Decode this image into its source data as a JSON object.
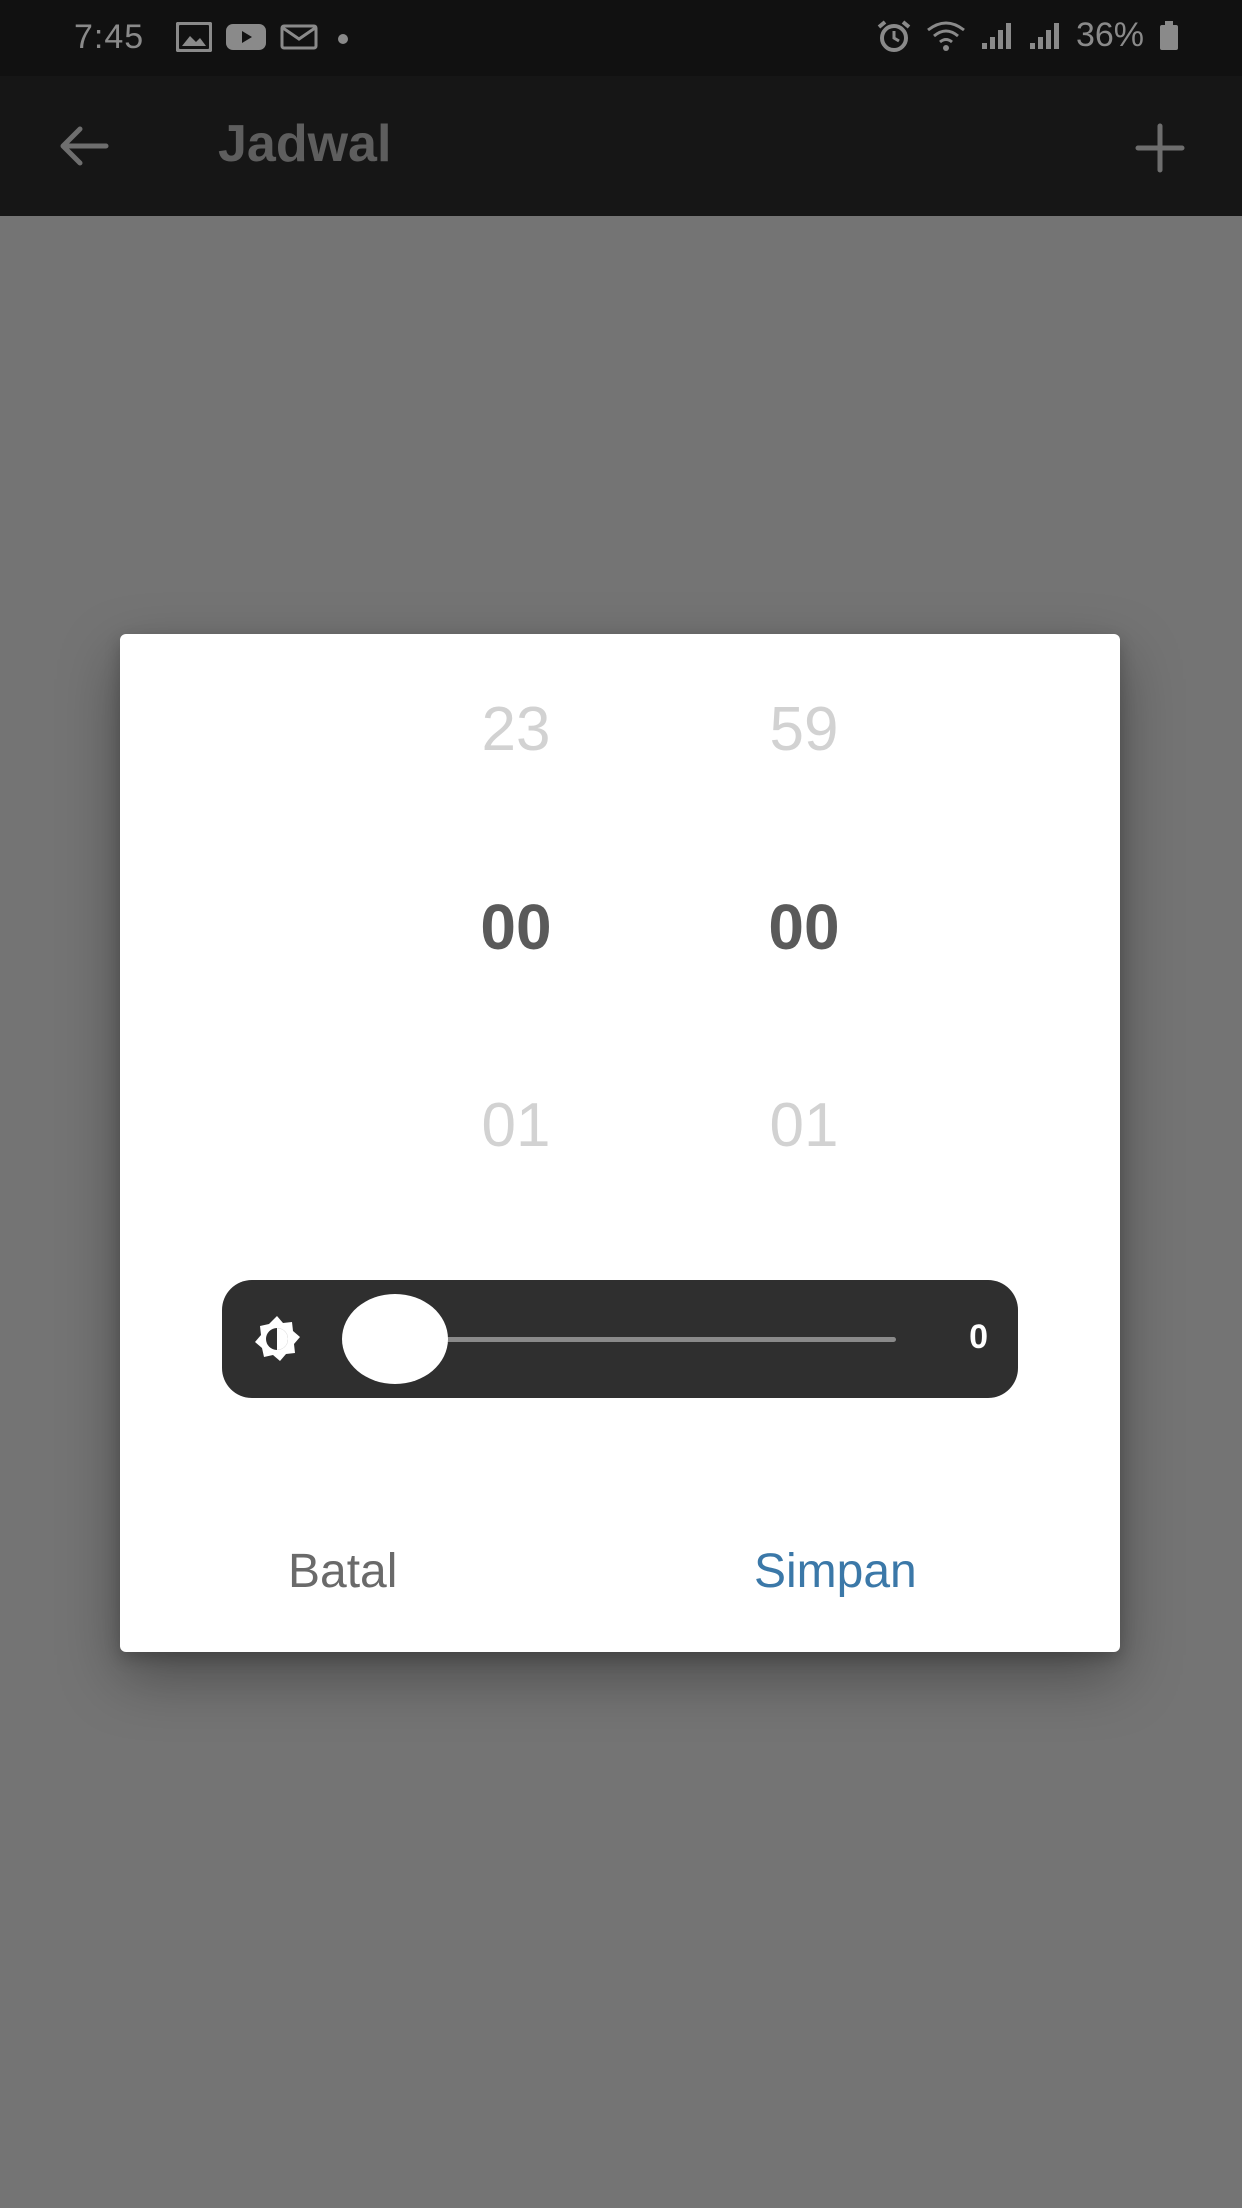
{
  "status_bar": {
    "time": "7:45",
    "battery": "36%",
    "left_icons": [
      "image-icon",
      "youtube-icon",
      "mail-icon",
      "dot-icon"
    ],
    "right_icons": [
      "alarm-icon",
      "wifi-icon",
      "signal-icon",
      "signal-icon",
      "battery-icon"
    ]
  },
  "app_bar": {
    "title": "Jadwal",
    "back_icon": "arrow-left-icon",
    "add_icon": "plus-icon"
  },
  "dialog": {
    "hour_picker": {
      "prev": "23",
      "current": "00",
      "next": "01"
    },
    "minute_picker": {
      "prev": "59",
      "current": "00",
      "next": "01"
    },
    "brightness": {
      "icon": "brightness-icon",
      "value": 0,
      "value_label": "0"
    },
    "cancel_label": "Batal",
    "save_label": "Simpan"
  },
  "colors": {
    "accent": "#3b78a8",
    "scrim": "#747474",
    "app_bar": "#161616"
  }
}
